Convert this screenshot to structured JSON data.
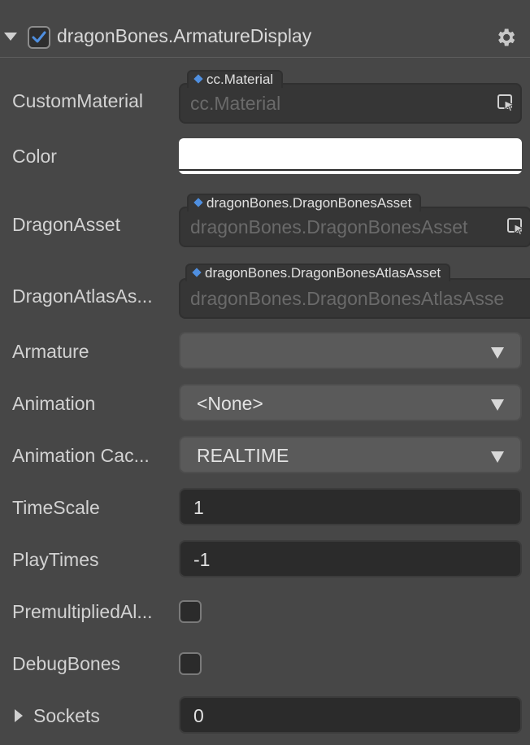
{
  "component": {
    "title": "dragonBones.ArmatureDisplay",
    "enabled": true
  },
  "fields": {
    "custom_material": {
      "label": "CustomMaterial",
      "type_tag": "cc.Material",
      "placeholder": "cc.Material"
    },
    "color": {
      "label": "Color",
      "value": "#FFFFFF"
    },
    "dragon_asset": {
      "label": "DragonAsset",
      "type_tag": "dragonBones.DragonBonesAsset",
      "placeholder": "dragonBones.DragonBonesAsset"
    },
    "dragon_atlas_asset": {
      "label": "DragonAtlasAs...",
      "type_tag": "dragonBones.DragonBonesAtlasAsset",
      "placeholder": "dragonBones.DragonBonesAtlasAsse"
    },
    "armature": {
      "label": "Armature",
      "value": ""
    },
    "animation": {
      "label": "Animation",
      "value": "<None>"
    },
    "animation_cache": {
      "label": "Animation Cac...",
      "value": "REALTIME"
    },
    "time_scale": {
      "label": "TimeScale",
      "value": "1"
    },
    "play_times": {
      "label": "PlayTimes",
      "value": "-1"
    },
    "premultiplied_alpha": {
      "label": "PremultipliedAl...",
      "checked": false
    },
    "debug_bones": {
      "label": "DebugBones",
      "checked": false
    },
    "sockets": {
      "label": "Sockets",
      "value": "0"
    }
  },
  "icons": {
    "collapse": "caret-down-icon",
    "settings": "gear-icon",
    "asset_picker": "asset-picker-icon",
    "expand": "caret-right-icon"
  },
  "colors": {
    "panel_bg": "#474747",
    "accent": "#4f8fe0"
  }
}
